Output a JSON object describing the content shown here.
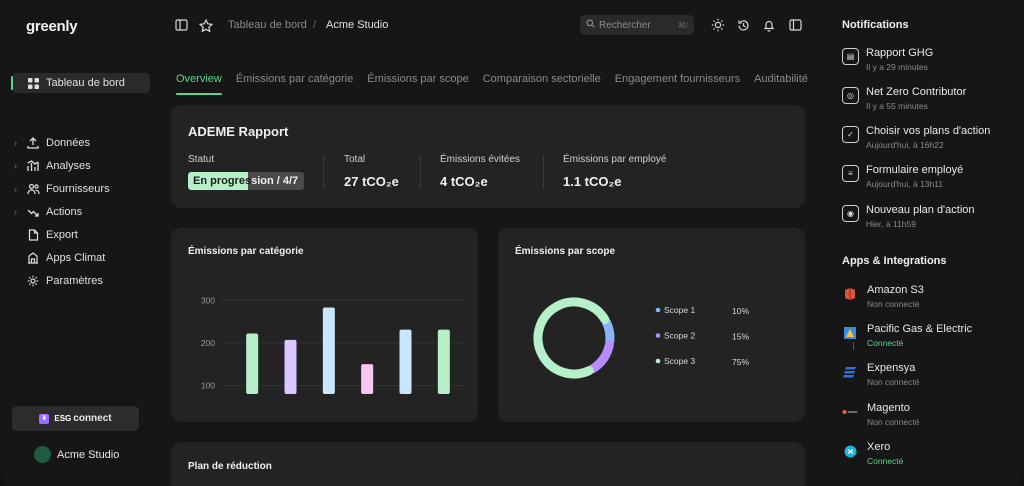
{
  "app": {
    "logo": "greenly"
  },
  "sidebar": {
    "items": [
      {
        "label": "Tableau de bord",
        "icon": "grid-icon",
        "active": true
      },
      {
        "label": "Données",
        "icon": "upload-icon",
        "chevron": true
      },
      {
        "label": "Analyses",
        "icon": "analytics-icon",
        "chevron": true
      },
      {
        "label": "Fournisseurs",
        "icon": "users-icon",
        "chevron": true
      },
      {
        "label": "Actions",
        "icon": "trend-icon",
        "chevron": true
      },
      {
        "label": "Export",
        "icon": "document-icon"
      },
      {
        "label": "Apps Climat",
        "icon": "building-icon"
      },
      {
        "label": "Paramètres",
        "icon": "gear-icon"
      }
    ],
    "esg": {
      "badge": "¥",
      "brand_small": "ESG",
      "brand_big": "connect"
    },
    "user": {
      "name": "Acme Studio"
    }
  },
  "topbar": {
    "breadcrumb": [
      "Tableau de bord",
      "/",
      "Acme Studio"
    ],
    "search": {
      "placeholder": "Rechercher",
      "shortcut": "⌘/"
    }
  },
  "tabs": [
    "Overview",
    "Émissions par catégorie",
    "Émissions par scope",
    "Comparaison sectorielle",
    "Engagement fournisseurs",
    "Auditabilité"
  ],
  "report": {
    "title": "ADEME Rapport",
    "status": {
      "label": "Statut",
      "value_a": "En progres",
      "value_b": "sion / 4/7",
      "progress": 0.52
    },
    "kpis": [
      {
        "label": "Total",
        "value": "27 tCO₂e"
      },
      {
        "label": "Émissions évitées",
        "value": "4 tCO₂e"
      },
      {
        "label": "Émissions par employé",
        "value": "1.1 tCO₂e"
      }
    ]
  },
  "cards": {
    "category_title": "Émissions par catégorie",
    "scope_title": "Émissions par scope",
    "plan_title": "Plan de réduction"
  },
  "chart_data": [
    {
      "type": "bar",
      "title": "Émissions par catégorie",
      "ylim": [
        80,
        310
      ],
      "yticks": [
        "300",
        "200",
        "100"
      ],
      "values": [
        222,
        207,
        283,
        150,
        231,
        231
      ],
      "colors": [
        "#b6f0c8",
        "#dcc6ff",
        "#c9e6ff",
        "#f5c7f0",
        "#c9e6ff",
        "#b6f0c8"
      ],
      "grid": true
    },
    {
      "type": "pie",
      "title": "Émissions par scope",
      "series": [
        {
          "name": "Scope 1",
          "value": 10,
          "label": "10%",
          "color": "#8ab4ff"
        },
        {
          "name": "Scope 2",
          "value": 15,
          "label": "15%",
          "color": "#b88cff"
        },
        {
          "name": "Scope 3",
          "value": 75,
          "label": "75%",
          "color": "#b6f0c8"
        }
      ]
    }
  ],
  "notifications": {
    "title": "Notifications",
    "items": [
      {
        "title": "Rapport GHG",
        "time": "Il y a 29 minutes",
        "icon": "report-icon"
      },
      {
        "title": "Net Zero Contributor",
        "time": "Il y a 55 minutes",
        "icon": "globe-icon"
      },
      {
        "title": "Choisir vos plans d'action",
        "time": "Aujourd'hui, à 16h22",
        "icon": "plan-icon"
      },
      {
        "title": "Formulaire employé",
        "time": "Aujourd'hui, à 13h11",
        "icon": "form-icon"
      },
      {
        "title": "Nouveau plan d'action",
        "time": "Hier, à 11h59",
        "icon": "broadcast-icon"
      }
    ]
  },
  "integrations": {
    "title": "Apps & Integrations",
    "items": [
      {
        "name": "Amazon S3",
        "status": "Non connecté",
        "connected": false,
        "icon": "amazon-s3-icon",
        "color": "#e0553a"
      },
      {
        "name": "Pacific Gas & Electric",
        "status": "Connecté",
        "connected": true,
        "icon": "pge-icon",
        "color": "#3a8dde"
      },
      {
        "name": "Expensya",
        "status": "Non connecté",
        "connected": false,
        "icon": "expensya-icon",
        "color": "#2f6fe0"
      },
      {
        "name": "Magento",
        "status": "Non connecté",
        "connected": false,
        "icon": "magento-icon",
        "color": "#e86a2a"
      },
      {
        "name": "Xero",
        "status": "Connecté",
        "connected": true,
        "icon": "xero-icon",
        "color": "#1ab4d7"
      }
    ]
  }
}
